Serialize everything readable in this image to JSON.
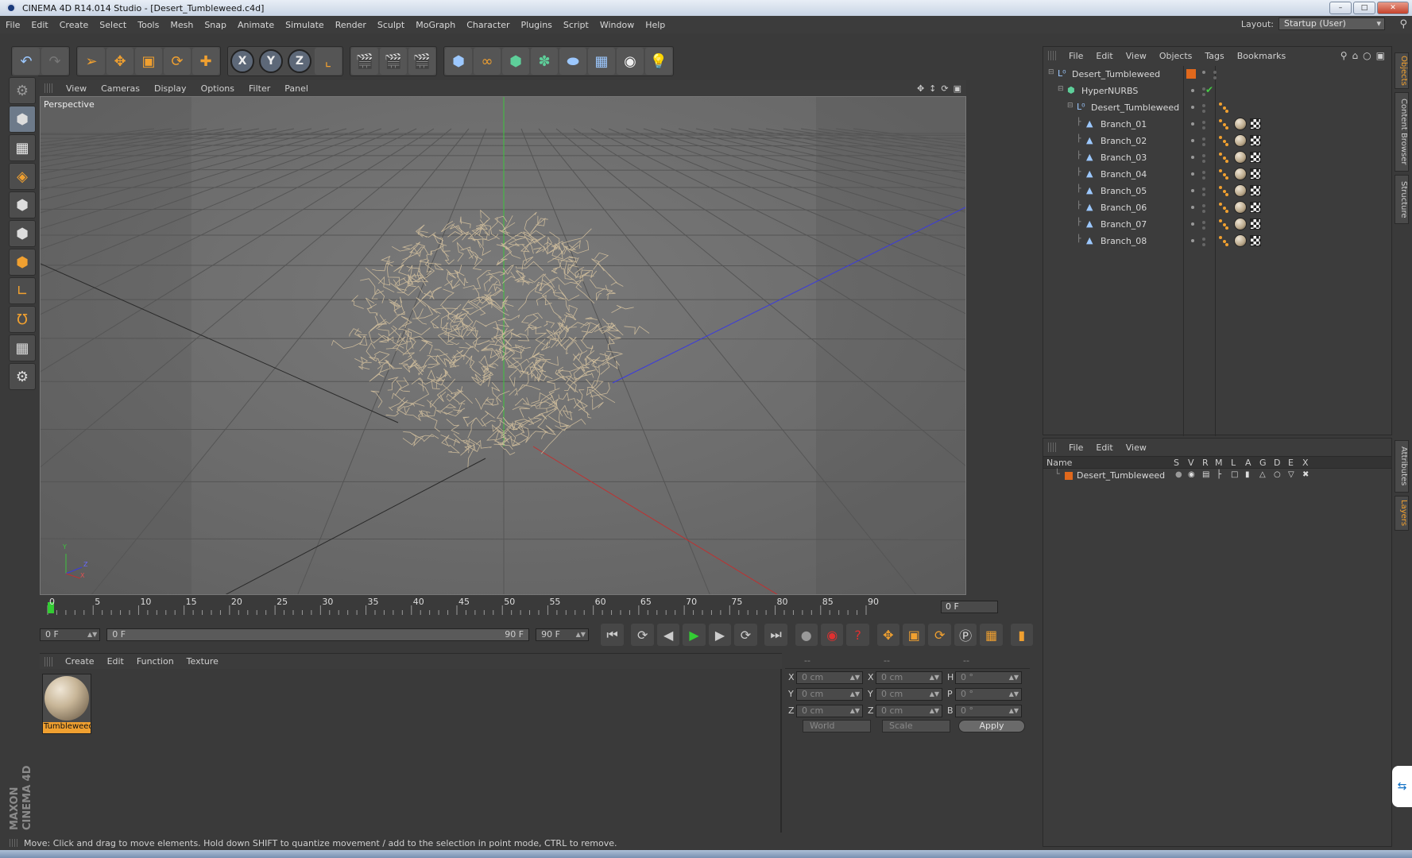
{
  "window": {
    "title": "CINEMA 4D R14.014 Studio - [Desert_Tumbleweed.c4d]",
    "buttons": [
      "–",
      "□",
      "✕"
    ]
  },
  "menubar": {
    "items": [
      "File",
      "Edit",
      "Create",
      "Select",
      "Tools",
      "Mesh",
      "Snap",
      "Animate",
      "Simulate",
      "Render",
      "Sculpt",
      "MoGraph",
      "Character",
      "Plugins",
      "Script",
      "Window",
      "Help"
    ],
    "layout_label": "Layout:",
    "layout_value": "Startup (User)"
  },
  "viewport": {
    "menu": [
      "View",
      "Cameras",
      "Display",
      "Options",
      "Filter",
      "Panel"
    ],
    "camera_label": "Perspective",
    "axis_labels": {
      "y": "Y",
      "z": "Z",
      "x": "X"
    }
  },
  "timeline": {
    "ticks": [
      "0",
      "5",
      "10",
      "15",
      "20",
      "25",
      "30",
      "35",
      "40",
      "45",
      "50",
      "55",
      "60",
      "65",
      "70",
      "75",
      "80",
      "85",
      "90"
    ],
    "current_frame": "0 F",
    "start_field": "0 F",
    "range_start": "0 F",
    "range_end": "90 F",
    "end_field": "90 F"
  },
  "material_manager": {
    "menu": [
      "Create",
      "Edit",
      "Function",
      "Texture"
    ],
    "materials": [
      {
        "name": "Tumbleweed"
      }
    ]
  },
  "coordinates": {
    "header": [
      "--",
      "--",
      "--"
    ],
    "rows": [
      {
        "a1": "X",
        "v1": "0 cm",
        "a2": "X",
        "v2": "0 cm",
        "a3": "H",
        "v3": "0 °"
      },
      {
        "a1": "Y",
        "v1": "0 cm",
        "a2": "Y",
        "v2": "0 cm",
        "a3": "P",
        "v3": "0 °"
      },
      {
        "a1": "Z",
        "v1": "0 cm",
        "a2": "Z",
        "v2": "0 cm",
        "a3": "B",
        "v3": "0 °"
      }
    ],
    "space_select": "World",
    "mode_select": "Scale",
    "apply_label": "Apply"
  },
  "object_manager": {
    "menu": [
      "File",
      "Edit",
      "View",
      "Objects",
      "Tags",
      "Bookmarks"
    ],
    "objects": [
      {
        "name": "Desert_Tumbleweed",
        "type": "null"
      },
      {
        "name": "HyperNURBS",
        "type": "hypernurbs"
      },
      {
        "name": "Desert_Tumbleweed",
        "type": "null"
      },
      {
        "name": "Branch_01",
        "type": "spline"
      },
      {
        "name": "Branch_02",
        "type": "spline"
      },
      {
        "name": "Branch_03",
        "type": "spline"
      },
      {
        "name": "Branch_04",
        "type": "spline"
      },
      {
        "name": "Branch_05",
        "type": "spline"
      },
      {
        "name": "Branch_06",
        "type": "spline"
      },
      {
        "name": "Branch_07",
        "type": "spline"
      },
      {
        "name": "Branch_08",
        "type": "spline"
      }
    ]
  },
  "layer_manager": {
    "menu": [
      "File",
      "Edit",
      "View"
    ],
    "columns": [
      "Name",
      "S",
      "V",
      "R",
      "M",
      "L",
      "A",
      "G",
      "D",
      "E",
      "X"
    ],
    "layers": [
      {
        "name": "Desert_Tumbleweed",
        "color": "#e0681c"
      }
    ]
  },
  "right_tabs": [
    "Objects",
    "Content Browser",
    "Structure",
    "Attributes",
    "Layers"
  ],
  "status_text": "Move: Click and drag to move elements. Hold down SHIFT to quantize movement / add to the selection in point mode, CTRL to remove.",
  "branding": "MAXON CINEMA 4D",
  "colors": {
    "accent": "#f0a030",
    "layer": "#e0681c",
    "play": "#33cc33",
    "record": "#e03030"
  }
}
